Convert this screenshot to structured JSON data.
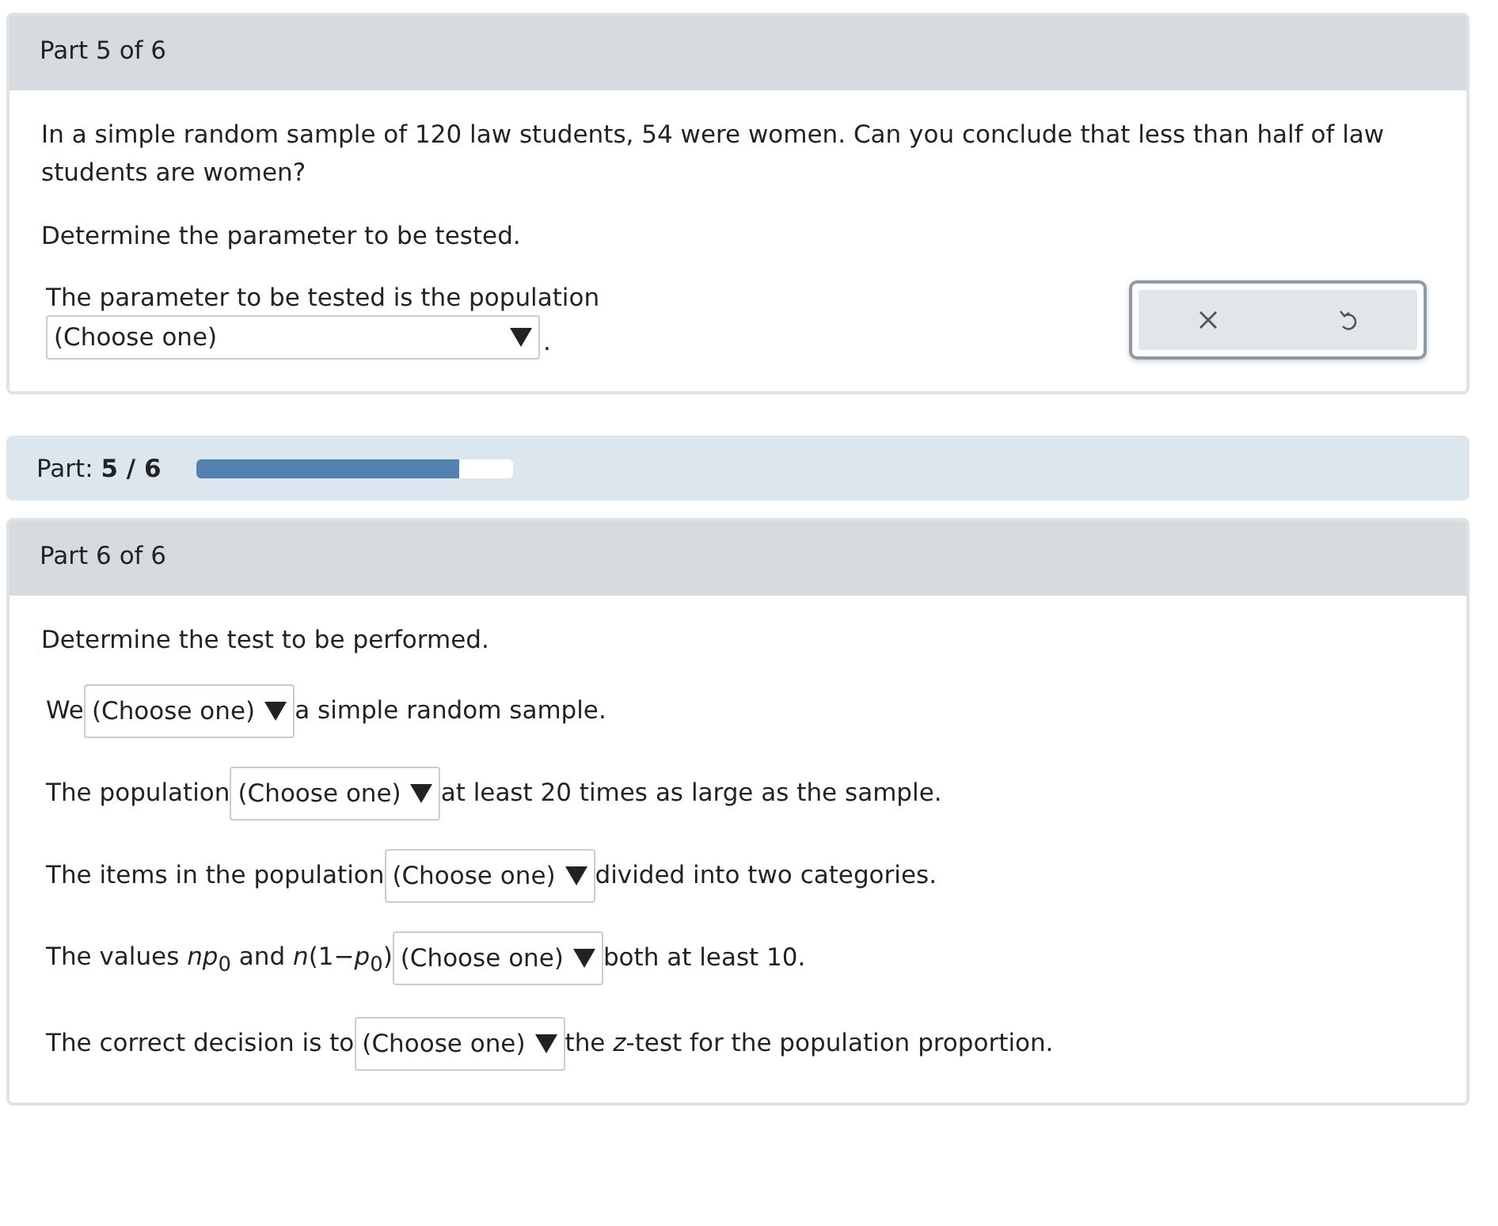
{
  "part5": {
    "header": "Part 5 of 6",
    "question": "In a simple random sample of 120 law students, 54 were women. Can you conclude that less than half of law students are women?",
    "instruction": "Determine the parameter to be tested.",
    "statement": {
      "before": "The parameter to be tested is the population",
      "dropdown": "(Choose one)",
      "after": "."
    }
  },
  "progress": {
    "label": "Part:",
    "value": "5 / 6",
    "level": 0.83
  },
  "part6": {
    "header": "Part 6 of 6",
    "instruction": "Determine the test to be performed.",
    "statements": [
      {
        "before": "We",
        "dropdown": "(Choose one)",
        "after": "a simple random sample."
      },
      {
        "before": "The population",
        "dropdown": "(Choose one)",
        "after": "at least 20 times as large as the sample."
      },
      {
        "before": "The items in the population",
        "dropdown": "(Choose one)",
        "after": "divided into two categories."
      },
      {
        "before": "The values *np*$_{0}$ and *n*(1−*p*$_{0}$)",
        "dropdown": "(Choose one)",
        "after": "both at least 10."
      },
      {
        "before": "The correct decision is to",
        "dropdown": "(Choose one)",
        "after": "the *z*-test for the population proportion."
      }
    ]
  }
}
